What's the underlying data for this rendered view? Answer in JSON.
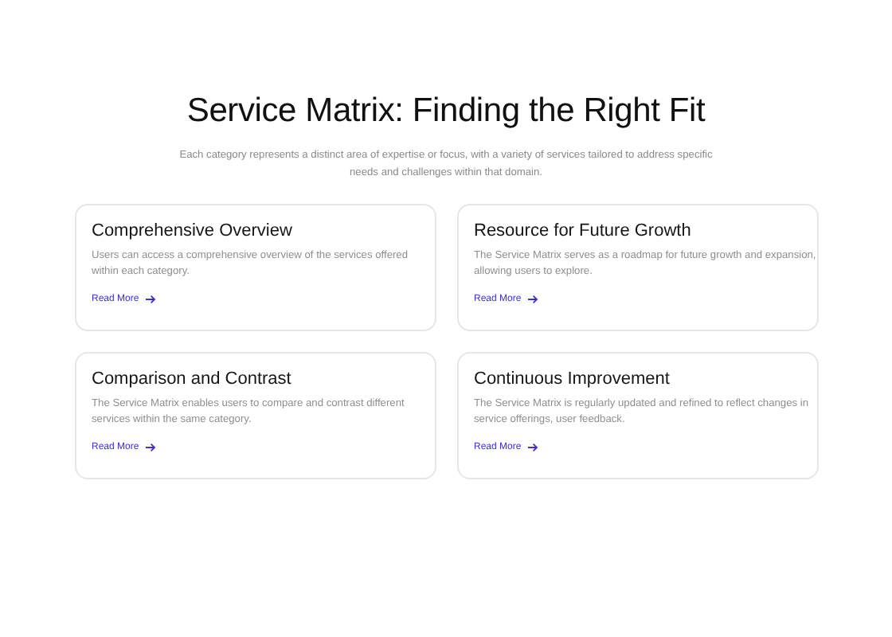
{
  "title": "Service Matrix: Finding the Right Fit",
  "subtitle": "Each category represents a distinct area of expertise or focus, with a variety of services tailored to address specific needs and challenges within that domain.",
  "cards": [
    {
      "title": "Comprehensive Overview",
      "text": "Users can access a comprehensive overview of the services offered within each category.",
      "link": "Read More"
    },
    {
      "title": "Resource for Future Growth",
      "text": "The Service Matrix serves as a roadmap for future growth and expansion, allowing users to explore.",
      "link": "Read More"
    },
    {
      "title": "Comparison and Contrast",
      "text": "The Service Matrix enables users to compare and contrast different services within the same category.",
      "link": "Read More"
    },
    {
      "title": "Continuous Improvement",
      "text": "The Service Matrix is regularly updated and refined to reflect changes in service offerings, user feedback.",
      "link": "Read More"
    }
  ]
}
